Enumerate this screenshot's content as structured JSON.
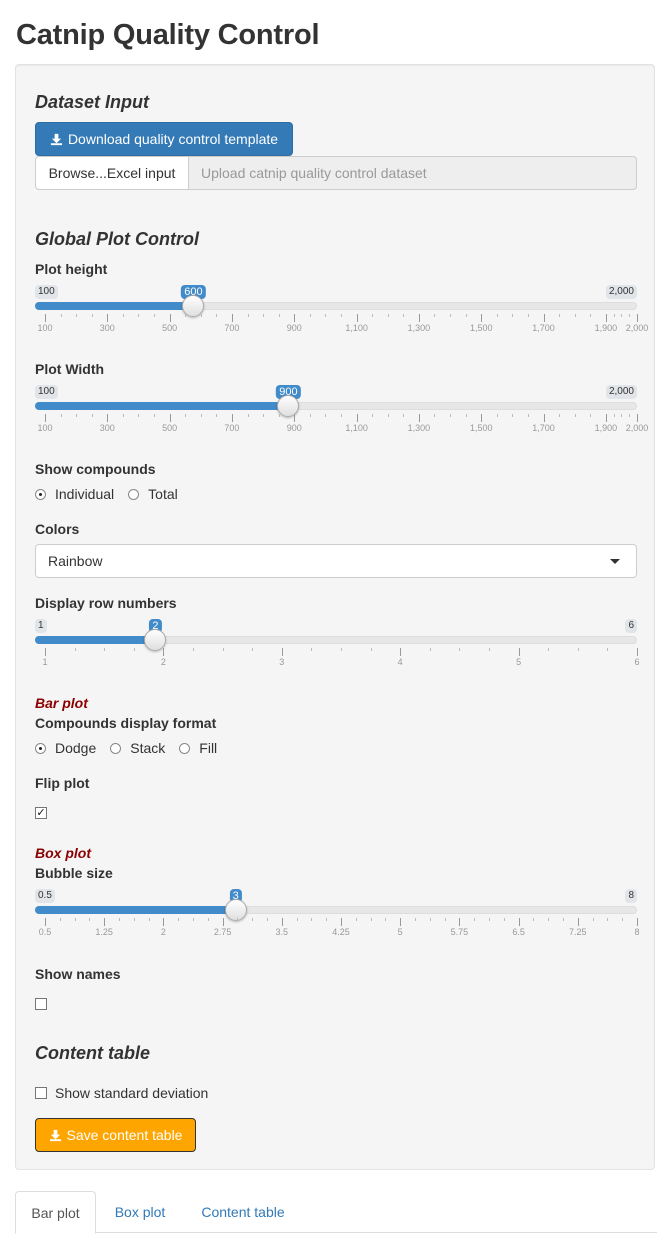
{
  "page_title": "Catnip Quality Control",
  "dataset_input": {
    "heading": "Dataset Input",
    "download_label": "Download quality control template",
    "browse_label": "Browse...Excel input",
    "file_placeholder": "Upload catnip quality control dataset"
  },
  "global_plot_control": {
    "heading": "Global Plot Control",
    "plot_height": {
      "label": "Plot height",
      "min_label": "100",
      "max_label": "2,000",
      "value_label": "600",
      "value": 600,
      "min": 100,
      "max": 2000,
      "ticks": [
        "100",
        "300",
        "500",
        "700",
        "900",
        "1,100",
        "1,300",
        "1,500",
        "1,700",
        "1,900",
        "2,000"
      ]
    },
    "plot_width": {
      "label": "Plot Width",
      "min_label": "100",
      "max_label": "2,000",
      "value_label": "900",
      "value": 900,
      "min": 100,
      "max": 2000,
      "ticks": [
        "100",
        "300",
        "500",
        "700",
        "900",
        "1,100",
        "1,300",
        "1,500",
        "1,700",
        "1,900",
        "2,000"
      ]
    },
    "show_compounds": {
      "label": "Show compounds",
      "options": [
        "Individual",
        "Total"
      ],
      "selected": "Individual"
    },
    "colors": {
      "label": "Colors",
      "selected": "Rainbow"
    },
    "display_row_numbers": {
      "label": "Display row numbers",
      "min_label": "1",
      "max_label": "6",
      "value_label": "2",
      "value": 2,
      "min": 1,
      "max": 6,
      "ticks": [
        "1",
        "2",
        "3",
        "4",
        "5",
        "6"
      ]
    }
  },
  "bar_plot": {
    "heading": "Bar plot",
    "format_label": "Compounds display format",
    "options": [
      "Dodge",
      "Stack",
      "Fill"
    ],
    "selected": "Dodge",
    "flip_label": "Flip plot",
    "flip_checked": true
  },
  "box_plot": {
    "heading": "Box plot",
    "bubble_size": {
      "label": "Bubble size",
      "min_label": "0.5",
      "max_label": "8",
      "value_label": "3",
      "value": 3,
      "min": 0.5,
      "max": 8,
      "ticks": [
        "0.5",
        "1.25",
        "2",
        "2.75",
        "3.5",
        "4.25",
        "5",
        "5.75",
        "6.5",
        "7.25",
        "8"
      ]
    },
    "show_names_label": "Show names",
    "show_names_checked": false
  },
  "content_table": {
    "heading": "Content table",
    "show_sd_label": "Show standard deviation",
    "show_sd_checked": false,
    "save_label": "Save content table"
  },
  "tabs": [
    "Bar plot",
    "Box plot",
    "Content table"
  ],
  "active_tab": "Bar plot",
  "colors": {
    "primary": "#337ab7",
    "slider_blue": "#428bca",
    "save_orange": "#ffa500",
    "subheading_red": "#8b0000"
  }
}
